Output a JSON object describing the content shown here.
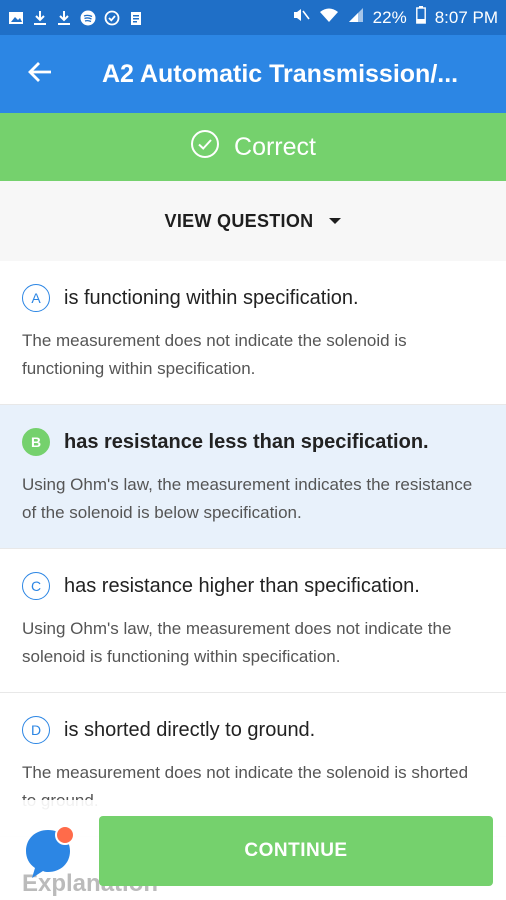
{
  "status_bar": {
    "battery": "22%",
    "time": "8:07 PM",
    "icons": [
      "image-icon",
      "download-icon",
      "download-icon",
      "spotify-icon",
      "check-circle-icon",
      "clipboard-icon",
      "mute-icon",
      "wifi-icon",
      "signal-icon",
      "battery-icon"
    ]
  },
  "header": {
    "title": "A2 Automatic Transmission/..."
  },
  "result": {
    "label": "Correct",
    "color": "#75d16d"
  },
  "view_question": {
    "label": "VIEW QUESTION"
  },
  "options": [
    {
      "letter": "A",
      "text": "is functioning within specification.",
      "explanation": "The measurement does not indicate the solenoid is functioning within specification.",
      "selected": false,
      "correct": false
    },
    {
      "letter": "B",
      "text": "has resistance less than specification.",
      "explanation": "Using Ohm's law, the measurement indicates the resistance of the solenoid is below specification.",
      "selected": true,
      "correct": true
    },
    {
      "letter": "C",
      "text": "has resistance higher than specification.",
      "explanation": "Using Ohm's law, the measurement does not indicate the solenoid is functioning within specification.",
      "selected": false,
      "correct": false
    },
    {
      "letter": "D",
      "text": "is shorted directly to ground.",
      "explanation": "The measurement does not indicate the solenoid is shorted to ground.",
      "selected": false,
      "correct": false
    }
  ],
  "explanation_heading": "Explanation",
  "continue": {
    "label": "CONTINUE"
  },
  "colors": {
    "primary": "#2c86e4",
    "status_bar": "#1f6fc7",
    "success": "#75d16d",
    "selected_bg": "#e8f1fb"
  }
}
